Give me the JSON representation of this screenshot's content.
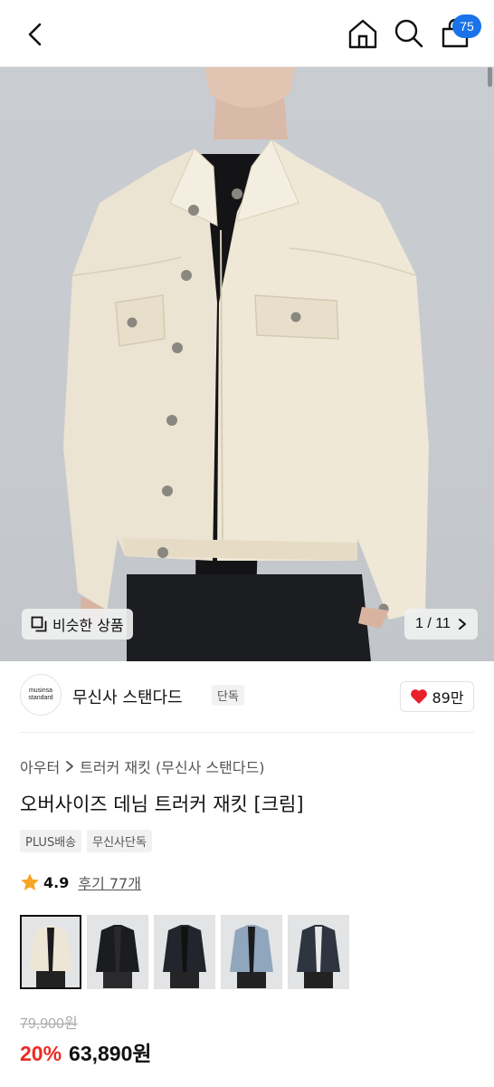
{
  "header": {
    "cart_count": "75",
    "icons": [
      "chevron-left-icon",
      "home-icon",
      "search-icon",
      "shopping-bag-icon"
    ]
  },
  "image": {
    "similar_label": "비슷한 상품",
    "page_indicator": "1 / 11"
  },
  "brand": {
    "logo_text_1": "musinsa",
    "logo_text_2": "standard",
    "name": "무신사 스탠다드",
    "tag": "단독",
    "likes": "89만"
  },
  "breadcrumb": {
    "category": "아우터",
    "subcategory": "트러커 재킷 (무신사 스탠다드)"
  },
  "product": {
    "title": "오버사이즈 데님 트러커 재킷 [크림]",
    "badges": [
      "PLUS배송",
      "무신사단독"
    ],
    "rating": "4.9",
    "reviews": "후기 77개",
    "colors": [
      {
        "name": "cream",
        "hex": "#ede6d6"
      },
      {
        "name": "black",
        "hex": "#1b1c20"
      },
      {
        "name": "dark-black",
        "hex": "#22252b"
      },
      {
        "name": "light-blue",
        "hex": "#8fa6bd"
      },
      {
        "name": "dark-indigo",
        "hex": "#2e3540"
      }
    ],
    "original_price": "79,900원",
    "discount": "20%",
    "sale_price": "63,890원"
  },
  "colors": {
    "accent_blue": "#1a73e8",
    "sale_red": "#ee2a24",
    "heart": "#e8202a",
    "star": "#f6a623"
  }
}
